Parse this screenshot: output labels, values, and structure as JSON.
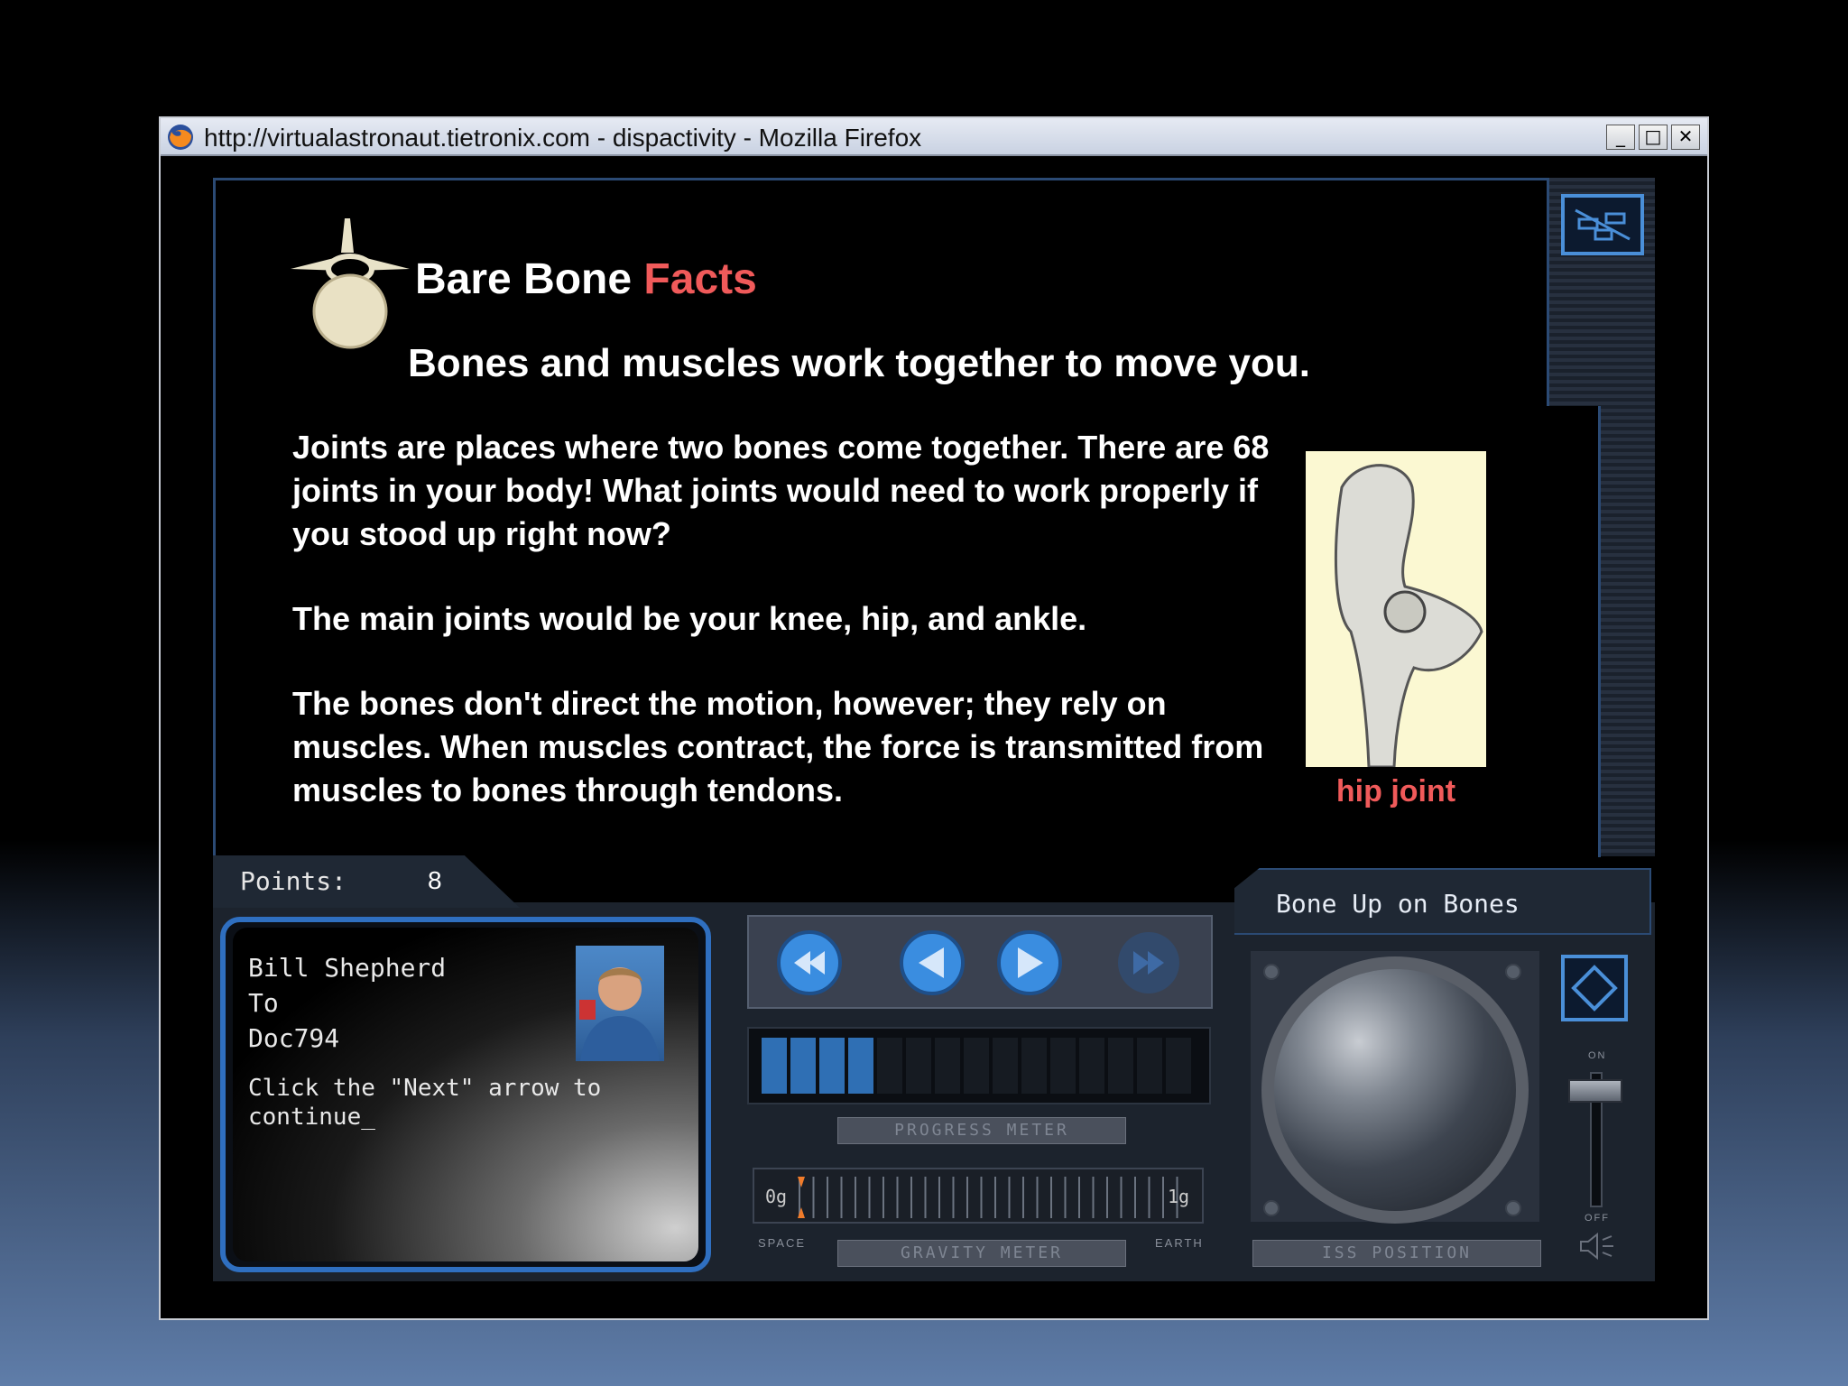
{
  "browser": {
    "title": "http://virtualastronaut.tietronix.com - dispactivity - Mozilla Firefox",
    "minimize": "_",
    "maximize": "□",
    "close": "✕"
  },
  "lesson": {
    "heading_main": "Bare Bone",
    "heading_accent": "Facts",
    "subheading": "Bones and muscles work together to move you.",
    "paragraphs": [
      "Joints are places where two bones come together. There are 68 joints in your body! What joints would need to work properly if you stood up right now?",
      "The main joints would be your knee, hip, and ankle.",
      "The bones don't direct the motion, however; they rely on muscles. When muscles contract, the force is transmitted from muscles to bones through tendons."
    ],
    "image_caption": "hip joint"
  },
  "points": {
    "label": "Points:",
    "value": "8"
  },
  "topic": {
    "title": "Bone Up on Bones"
  },
  "message": {
    "from": "Bill Shepherd",
    "to_label": "To",
    "recipient": "Doc794",
    "body": "Click the \"Next\" arrow to\ncontinue_"
  },
  "controls": {
    "first_icon": "rewind-icon",
    "prev_icon": "prev-arrow-icon",
    "next_icon": "next-arrow-icon",
    "last_icon": "fast-forward-icon"
  },
  "progress_meter": {
    "label": "PROGRESS METER",
    "segments_total": 15,
    "segments_filled": 4
  },
  "gravity_meter": {
    "label": "GRAVITY METER",
    "min_label": "0g",
    "max_label": "1g",
    "left_caption": "SPACE",
    "right_caption": "EARTH"
  },
  "iss_position": {
    "label": "ISS POSITION"
  },
  "volume": {
    "on_label": "ON",
    "off_label": "OFF",
    "icon": "speaker-icon"
  },
  "colors": {
    "accent_red": "#f05a5a",
    "panel_blue": "#2f6fc0",
    "progress_blue": "#2f6fb4"
  }
}
